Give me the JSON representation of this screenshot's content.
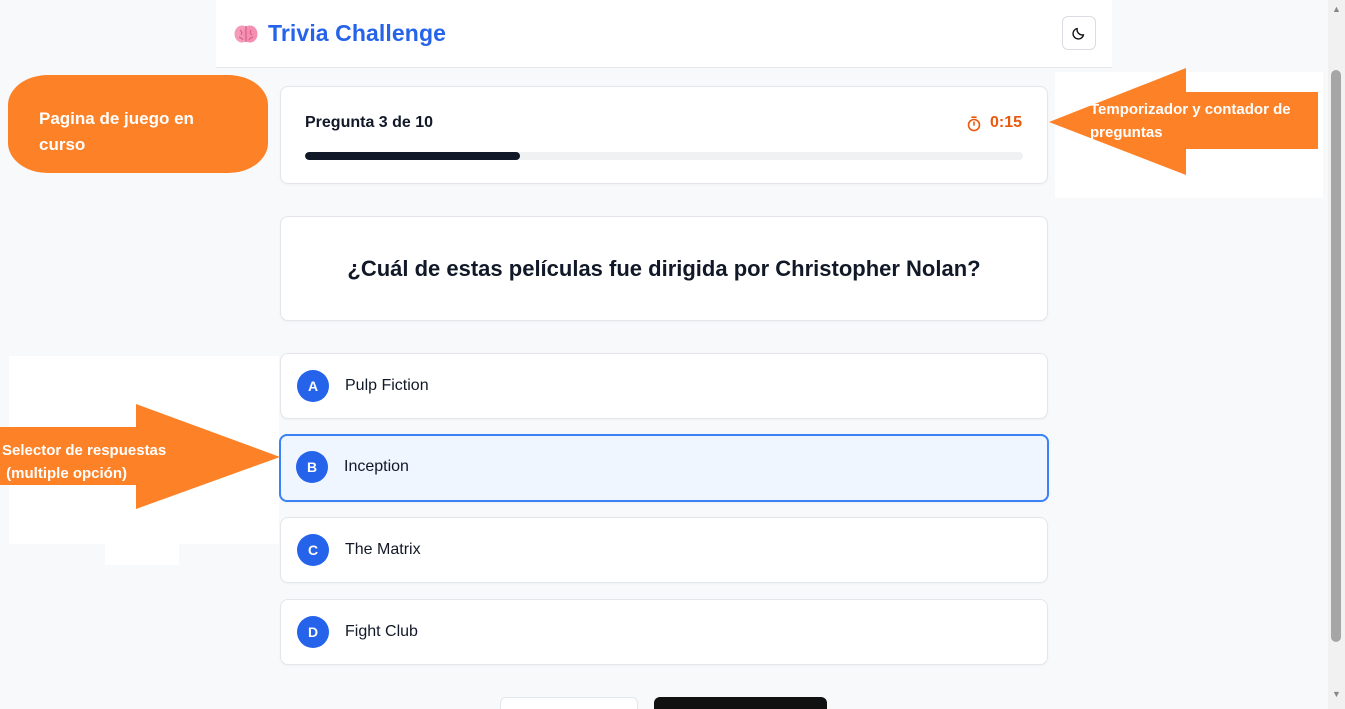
{
  "header": {
    "title": "Trivia Challenge",
    "brand_icon": "brain-icon",
    "theme_icon": "moon-icon"
  },
  "progress": {
    "counter": "Pregunta 3 de 10",
    "timer": "0:15",
    "timer_icon": "stopwatch-icon",
    "fraction": 0.3
  },
  "question": {
    "text": "¿Cuál de estas películas fue dirigida por Christopher Nolan?"
  },
  "options": [
    {
      "letter": "A",
      "text": "Pulp Fiction",
      "selected": false
    },
    {
      "letter": "B",
      "text": "Inception",
      "selected": true
    },
    {
      "letter": "C",
      "text": "The Matrix",
      "selected": false
    },
    {
      "letter": "D",
      "text": "Fight Club",
      "selected": false
    }
  ],
  "annotations": {
    "page_label": "Pagina de juego en curso",
    "timer_label": "Temporizador y contador de preguntas",
    "selector_label": "Selector de respuestas\n (multiple opción)"
  },
  "colors": {
    "brand": "#2563eb",
    "timer": "#ea580c",
    "annotation": "#fd8126",
    "selected_bg": "#eff6ff"
  }
}
